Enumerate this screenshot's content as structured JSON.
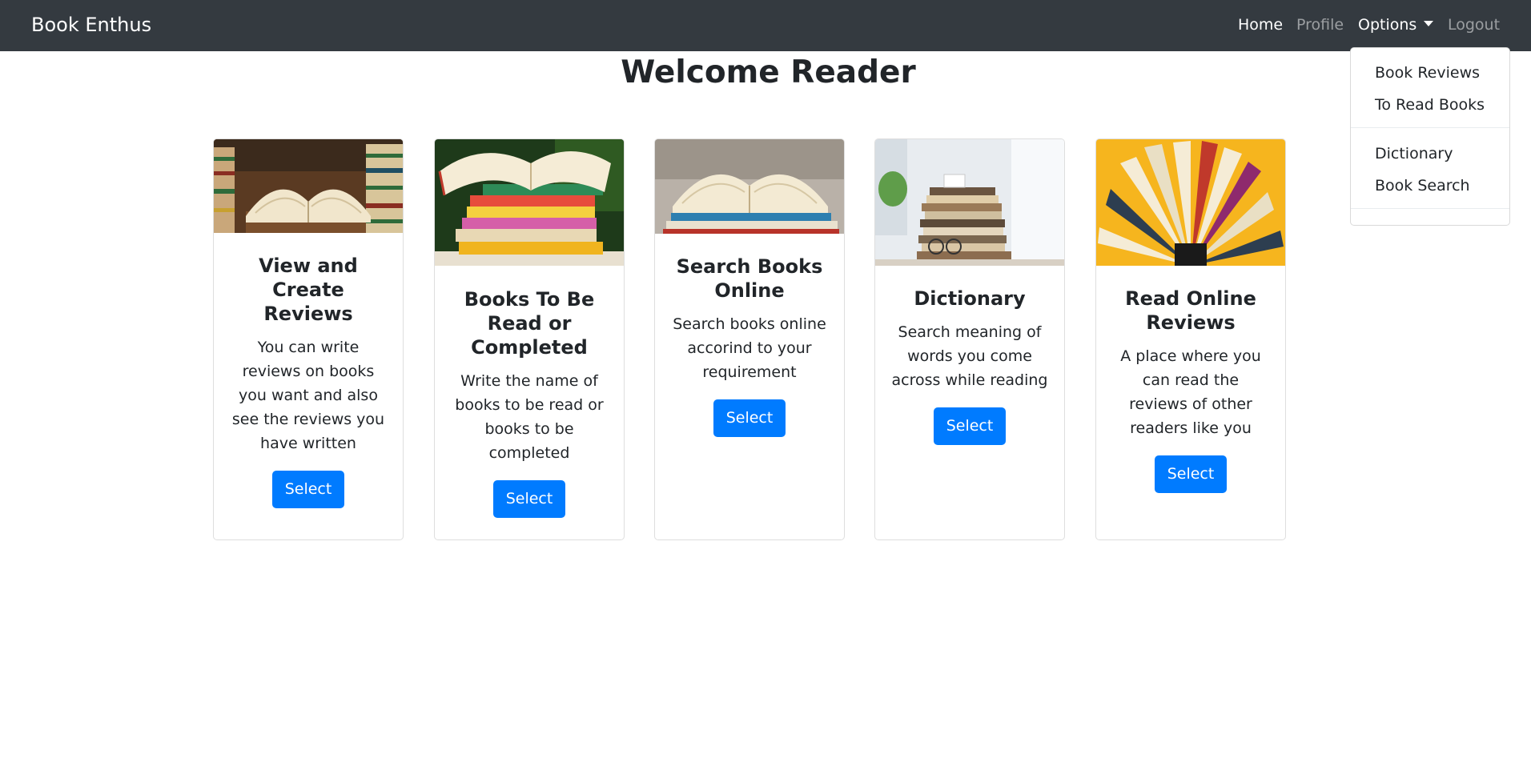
{
  "navbar": {
    "brand": "Book Enthus",
    "home": "Home",
    "profile": "Profile",
    "options": "Options",
    "logout": "Logout"
  },
  "dropdown": {
    "items": [
      "Book Reviews",
      "To Read Books",
      "Dictionary",
      "Book Search"
    ]
  },
  "page": {
    "title": "Welcome Reader"
  },
  "cards": [
    {
      "title": "View and Create Reviews",
      "text": "You can write reviews on books you want and also see the reviews you have written",
      "button": "Select"
    },
    {
      "title": "Books To Be Read or Completed",
      "text": "Write the name of books to be read or books to be completed",
      "button": "Select"
    },
    {
      "title": "Search Books Online",
      "text": "Search books online accorind to your requirement",
      "button": "Select"
    },
    {
      "title": "Dictionary",
      "text": "Search meaning of words you come across while reading",
      "button": "Select"
    },
    {
      "title": "Read Online Reviews",
      "text": "A place where you can read the reviews of other readers like you",
      "button": "Select"
    }
  ],
  "colors": {
    "navbar_bg": "#343a40",
    "button_bg": "#007bff"
  }
}
